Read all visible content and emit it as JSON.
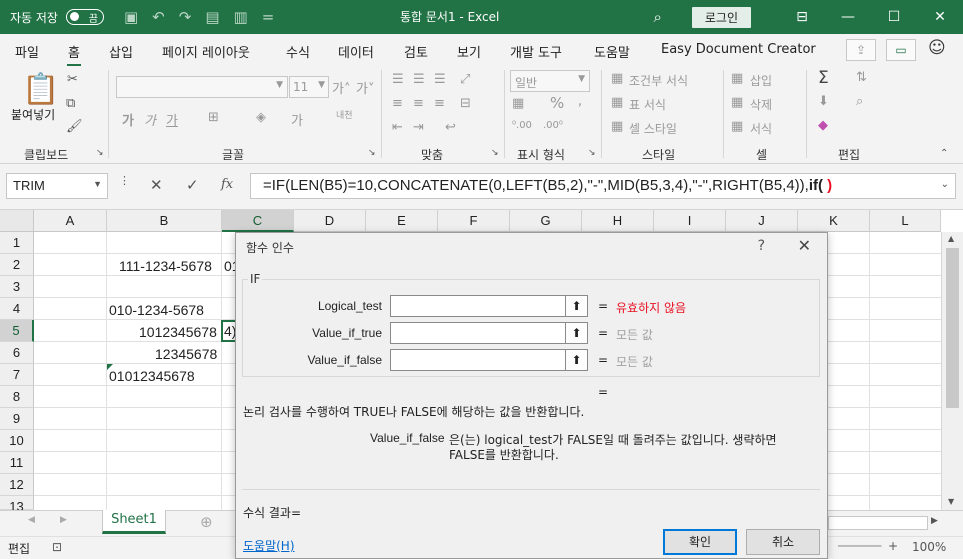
{
  "titlebar": {
    "autosave_label": "자동 저장",
    "autosave_state": "끔",
    "title": "통합 문서1  -  Excel",
    "login_label": "로그인"
  },
  "menu": {
    "items": [
      "파일",
      "홈",
      "삽입",
      "페이지 레이아웃",
      "수식",
      "데이터",
      "검토",
      "보기",
      "개발 도구",
      "도움말",
      "Easy Document Creator"
    ],
    "active_index": 1
  },
  "ribbon": {
    "paste_label": "붙여넣기",
    "font_size": "11",
    "number_format": "일반",
    "style_items": [
      "조건부 서식",
      "표 서식",
      "셀 스타일"
    ],
    "cell_items": [
      "삽입",
      "삭제",
      "서식"
    ],
    "groups": [
      "클립보드",
      "글꼴",
      "맞춤",
      "표시 형식",
      "스타일",
      "셀",
      "편집"
    ]
  },
  "formula_bar": {
    "name_box": "TRIM",
    "fx_label": "fx",
    "formula_main": "=IF(LEN(B5)=10,CONCATENATE(0,LEFT(B5,2),\"-\",MID(B5,3,4),\"-\",RIGHT(B5,4)),",
    "formula_bold": "if(",
    "formula_red": " )"
  },
  "grid": {
    "columns": [
      "A",
      "B",
      "C",
      "D",
      "E",
      "F",
      "G",
      "H",
      "I",
      "J",
      "K",
      "L"
    ],
    "selected_column": "C",
    "rows": [
      "1",
      "2",
      "3",
      "4",
      "5",
      "6",
      "7",
      "8",
      "9",
      "10",
      "11",
      "12",
      "13"
    ],
    "selected_row": "5",
    "cells": {
      "B2": "111-1234-5678",
      "C2": "01",
      "B4": "010-1234-5678",
      "B5": "1012345678",
      "C5": "4)",
      "B6": "12345678",
      "B7": "01012345678"
    }
  },
  "sheets": [
    "Sheet1"
  ],
  "status": {
    "mode": "편집",
    "zoom": "100%"
  },
  "dialog": {
    "title": "함수 인수",
    "help_glyph": "?",
    "function_name": "IF",
    "args": [
      {
        "label": "Logical_test",
        "result": "유효하지 않음",
        "error": true
      },
      {
        "label": "Value_if_true",
        "result": "모든 값",
        "error": false
      },
      {
        "label": "Value_if_false",
        "result": "모든 값",
        "error": false
      }
    ],
    "equals": "=",
    "description": "논리 검사를 수행하여 TRUE나 FALSE에 해당하는 값을 반환합니다.",
    "arg_help_name": "Value_if_false",
    "arg_help_line1": "은(는) logical_test가 FALSE일 때 돌려주는 값입니다. 생략하면",
    "arg_help_line2": "FALSE를 반환합니다.",
    "result_label": "수식 결과=",
    "help_link": "도움말(H)",
    "ok_label": "확인",
    "cancel_label": "취소"
  },
  "colors": {
    "excel_green": "#217346",
    "error_red": "#e81123",
    "link_blue": "#0066cc"
  }
}
